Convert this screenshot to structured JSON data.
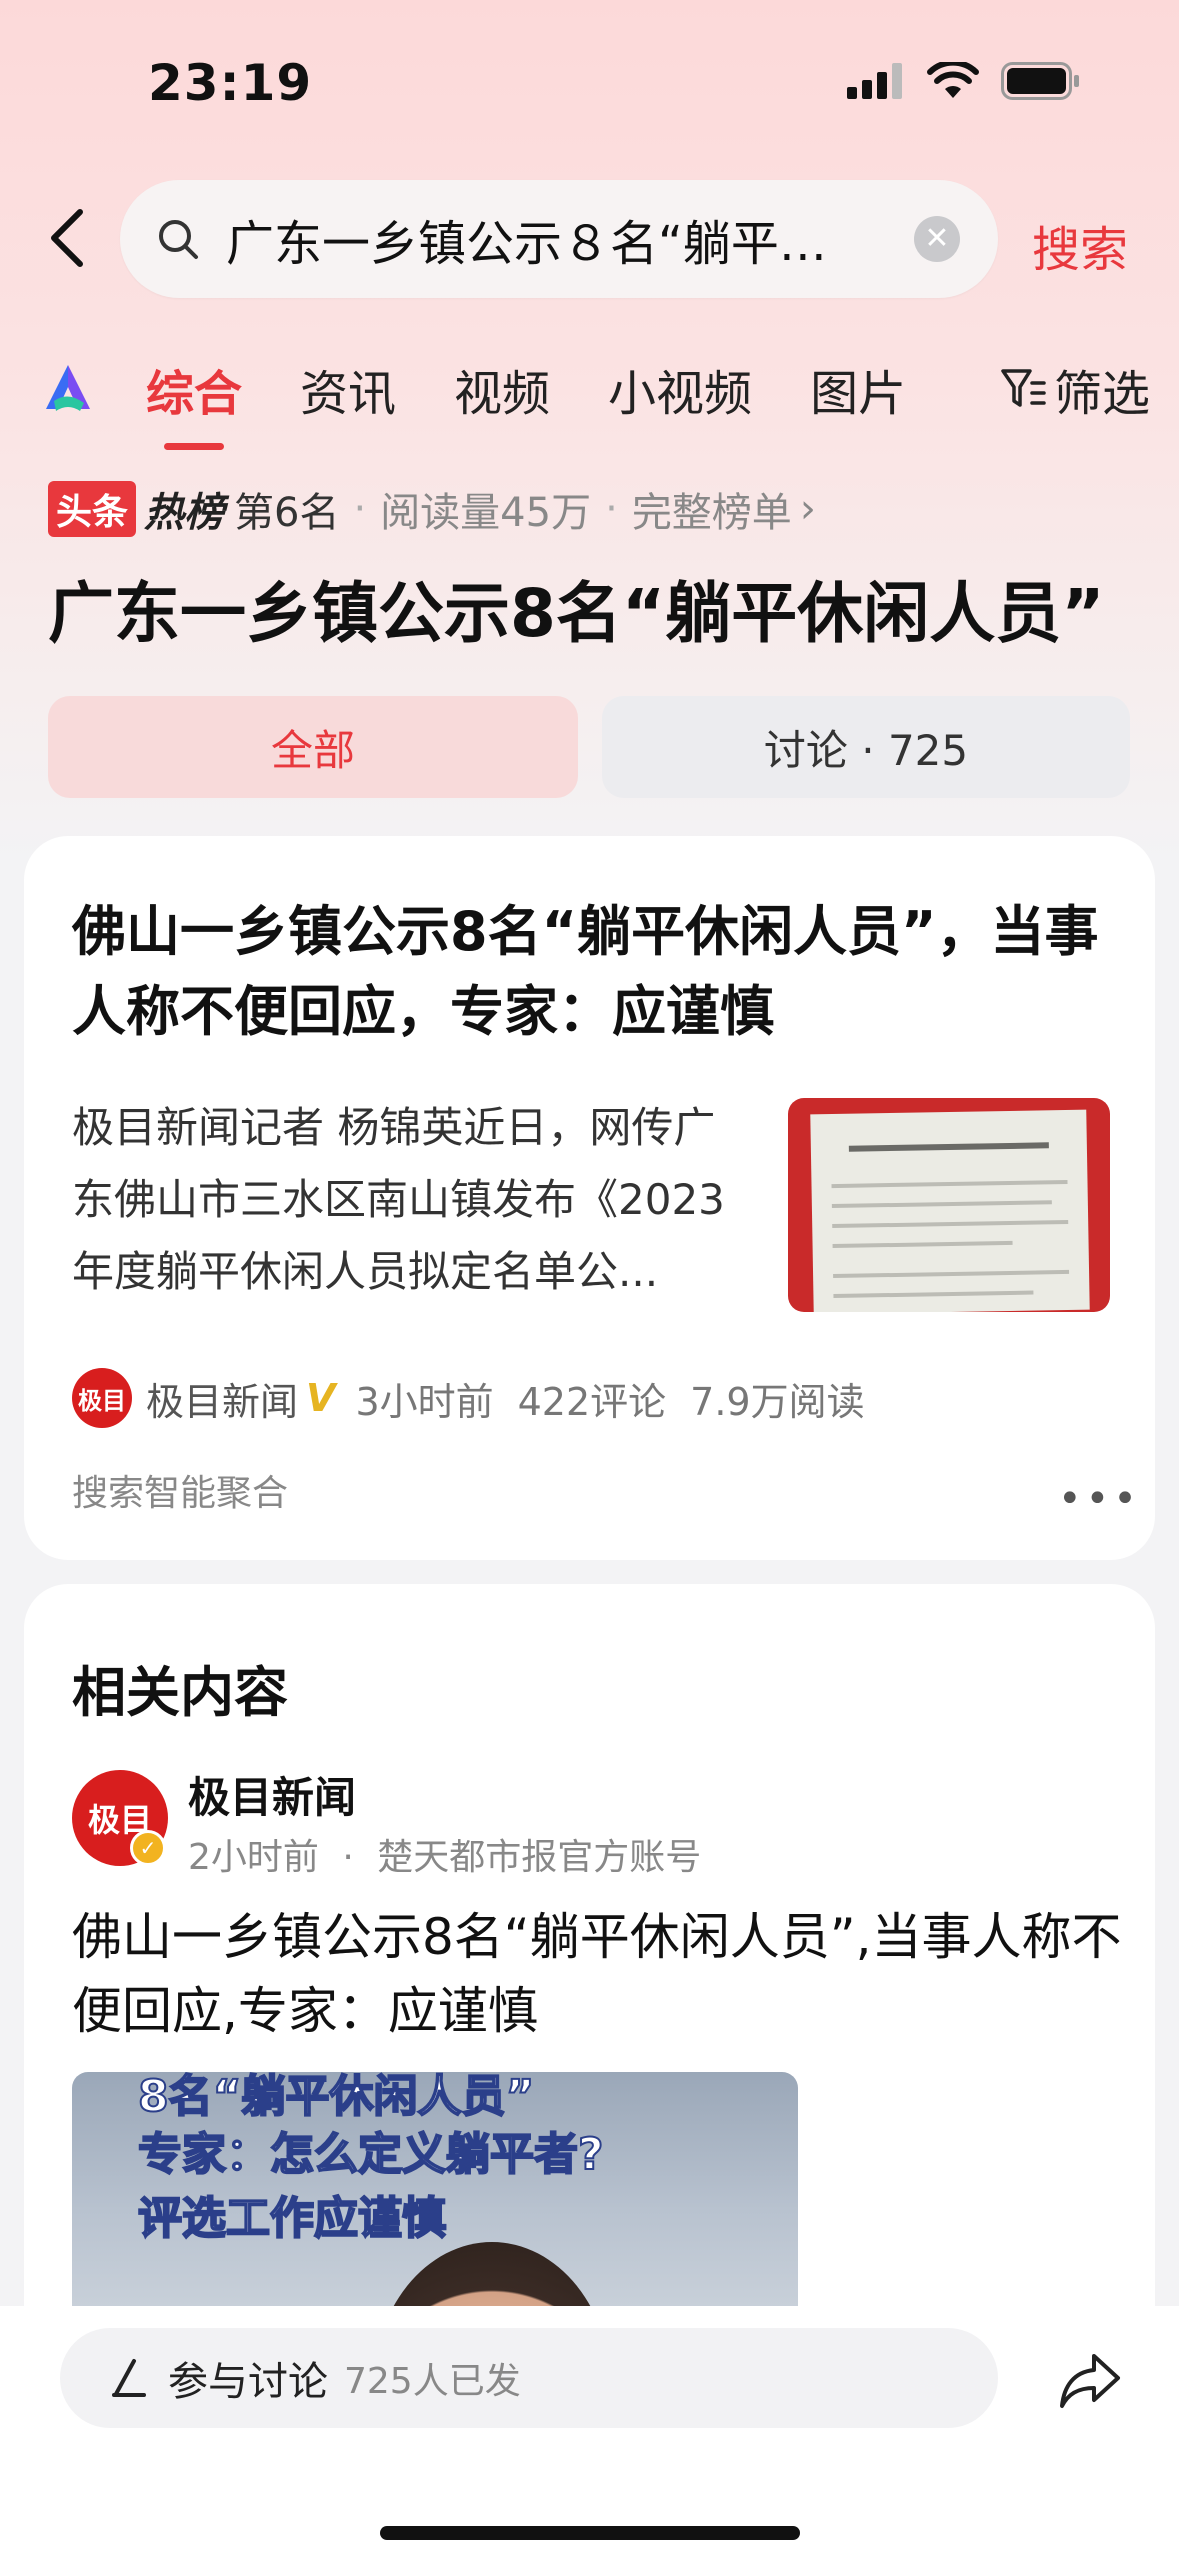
{
  "status": {
    "time": "23:19"
  },
  "search": {
    "query": "广东一乡镇公示８名“躺平…",
    "button": "搜索"
  },
  "tabs": [
    {
      "label": "综合",
      "active": true
    },
    {
      "label": "资讯",
      "active": false
    },
    {
      "label": "视频",
      "active": false
    },
    {
      "label": "小视频",
      "active": false
    },
    {
      "label": "图片",
      "active": false
    }
  ],
  "filter_label": "筛选",
  "rank": {
    "badge_toutiao": "头条",
    "badge_hot": "热榜",
    "position": "第6名",
    "reads": "阅读量45万",
    "full_list": "完整榜单"
  },
  "topic_title": "广东一乡镇公示8名“躺平休闲人员”",
  "segments": {
    "all": "全部",
    "discussion": "讨论 · 725"
  },
  "card1": {
    "title": "佛山一乡镇公示8名“躺平休闲人员”，当事人称不便回应，专家：应谨慎",
    "summary": "极目新闻记者 杨锦英近日，网传广东佛山市三水区南山镇发布《2023年度躺平休闲人员拟定名单公...",
    "source_logo_text": "极目",
    "source": "极目新闻",
    "verified_mark": "V",
    "time": "3小时前",
    "comments": "422评论",
    "reads": "7.9万阅读",
    "aggregation": "搜索智能聚合"
  },
  "card2": {
    "heading": "相关内容",
    "avatar_text": "极目",
    "author": "极目新闻",
    "time": "2小时前",
    "account_desc": "楚天都市报官方账号",
    "title": "佛山一乡镇公示8名“躺平休闲人员”,当事人称不便回应,专家：应谨慎",
    "image_caption_top": "8名“躺平休闲人员”",
    "image_caption_1": "专家：怎么定义躺平者?",
    "image_caption_2": "评选工作应谨慎"
  },
  "bottom": {
    "discuss_label": "参与讨论",
    "discuss_count": "725人已发"
  },
  "colors": {
    "accent": "#e8383d",
    "background": "#f3f3f5",
    "card": "#ffffff"
  }
}
